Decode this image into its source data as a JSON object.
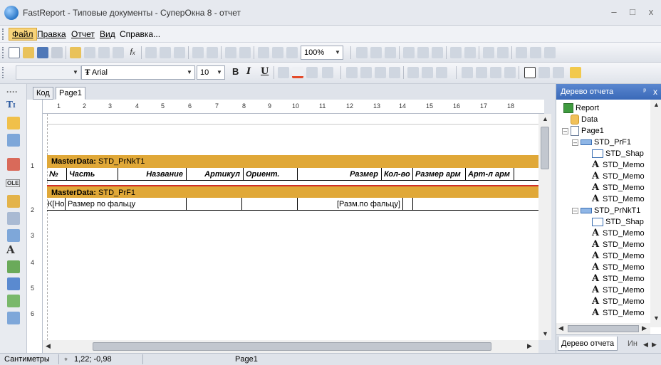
{
  "window": {
    "title": "FastReport - Типовые документы - СуперОкна 8 - отчет",
    "controls": [
      "–",
      "□",
      "x"
    ]
  },
  "menu": [
    "Файл",
    "Правка",
    "Отчет",
    "Вид",
    "Справка..."
  ],
  "toolbar_standard": {
    "zoom": "100%"
  },
  "toolbar_format": {
    "font_name": "Arial",
    "font_size": "10",
    "bold": "B",
    "italic": "I",
    "underline": "U"
  },
  "tabs": [
    "Код",
    "Page1"
  ],
  "ruler_h": [
    "1",
    "2",
    "3",
    "4",
    "5",
    "6",
    "7",
    "8",
    "9",
    "10",
    "11",
    "12",
    "13",
    "14",
    "15",
    "16",
    "17",
    "18"
  ],
  "ruler_v": [
    "1",
    "2",
    "3",
    "4",
    "5",
    "6"
  ],
  "bands": [
    {
      "type": "MasterData:",
      "name": "STD_PrNkT1",
      "cells": [
        "№",
        "Часть",
        "Название",
        "Артикул",
        "Ориент.",
        "Размер",
        "Кол-во",
        "Размер арм",
        "Арт-л арм"
      ]
    },
    {
      "type": "MasterData:",
      "name": "STD_PrF1",
      "cells": [
        "К[Но",
        "Размер по фальцу",
        "",
        "",
        "[Разм.по фальцу]",
        ""
      ]
    }
  ],
  "tree_panel": {
    "title": "Дерево отчета",
    "pin": "ᵖ",
    "close": "x",
    "nodes": [
      {
        "label": "Report",
        "icon": "report-icon",
        "level": 0
      },
      {
        "label": "Data",
        "icon": "data-icon",
        "level": 1
      },
      {
        "label": "Page1",
        "icon": "page-icon",
        "level": 1
      },
      {
        "label": "STD_PrF1",
        "icon": "band-icon",
        "level": 2
      },
      {
        "label": "STD_Shap",
        "icon": "shape-icon",
        "level": 3
      },
      {
        "label": "STD_Memo",
        "icon": "text-icon",
        "level": 3
      },
      {
        "label": "STD_Memo",
        "icon": "text-icon",
        "level": 3
      },
      {
        "label": "STD_Memo",
        "icon": "text-icon",
        "level": 3
      },
      {
        "label": "STD_Memo",
        "icon": "text-icon",
        "level": 3
      },
      {
        "label": "STD_PrNkT1",
        "icon": "band-icon",
        "level": 2
      },
      {
        "label": "STD_Shap",
        "icon": "shape-icon",
        "level": 3
      },
      {
        "label": "STD_Memo",
        "icon": "text-icon",
        "level": 3
      },
      {
        "label": "STD_Memo",
        "icon": "text-icon",
        "level": 3
      },
      {
        "label": "STD_Memo",
        "icon": "text-icon",
        "level": 3
      },
      {
        "label": "STD_Memo",
        "icon": "text-icon",
        "level": 3
      },
      {
        "label": "STD_Memo",
        "icon": "text-icon",
        "level": 3
      },
      {
        "label": "STD_Memo",
        "icon": "text-icon",
        "level": 3
      },
      {
        "label": "STD_Memo",
        "icon": "text-icon",
        "level": 3
      },
      {
        "label": "STD_Memo",
        "icon": "text-icon",
        "level": 3
      }
    ],
    "bottom_tabs": [
      "Дерево отчета",
      "Ин"
    ]
  },
  "status": {
    "units": "Сантиметры",
    "coords": "1,22; -0,98",
    "page": "Page1"
  },
  "colors": {
    "band": "#e0a838",
    "accent": "#3a69b8"
  }
}
